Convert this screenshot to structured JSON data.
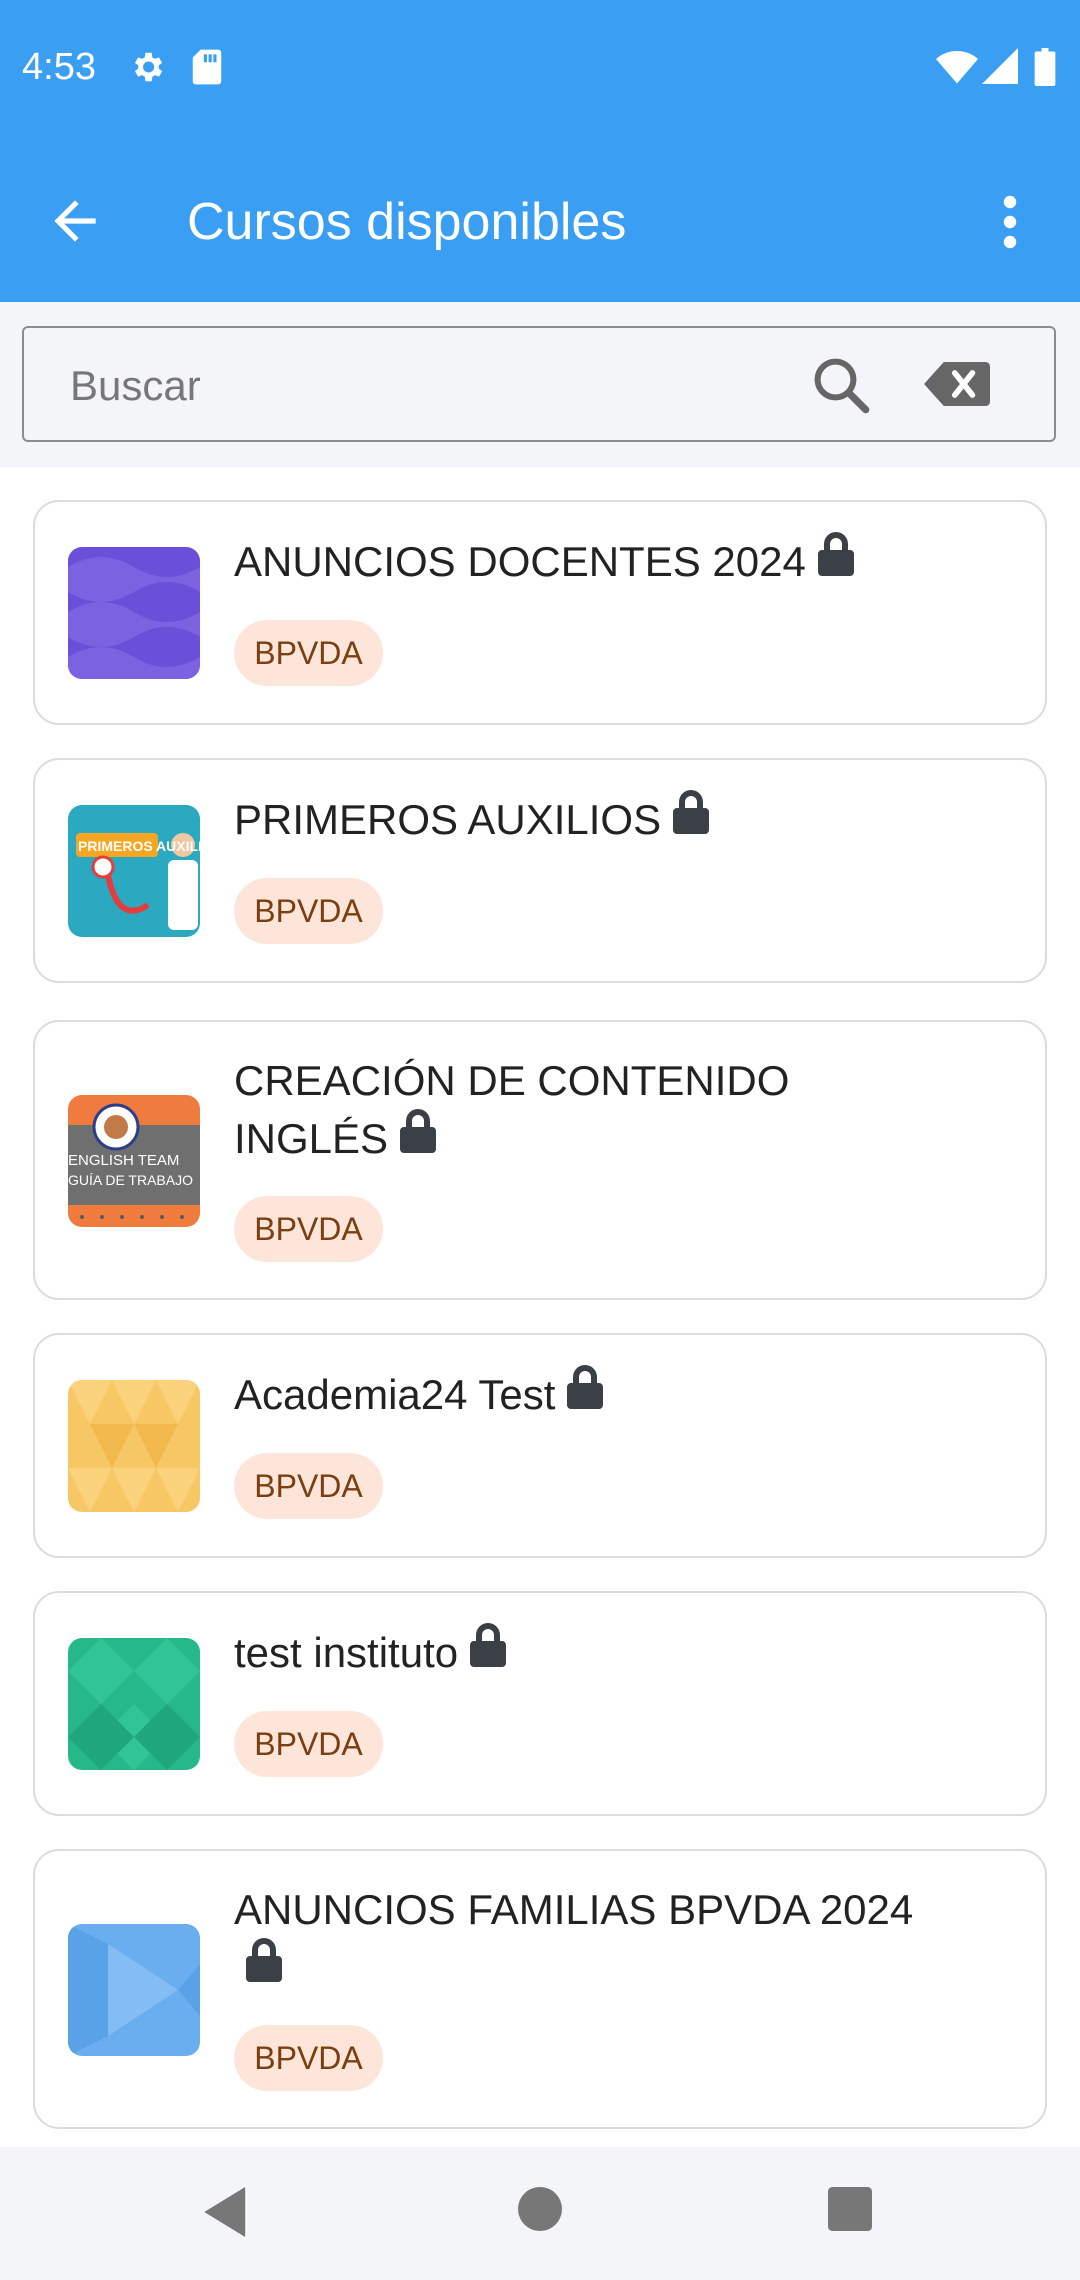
{
  "status": {
    "time": "4:53"
  },
  "header": {
    "title": "Cursos disponibles"
  },
  "search": {
    "placeholder": "Buscar",
    "value": ""
  },
  "courses": [
    {
      "title": "ANUNCIOS DOCENTES 2024",
      "badge": "BPVDA"
    },
    {
      "title": "PRIMEROS AUXILIOS",
      "badge": "BPVDA",
      "thumb_text": "PRIMEROS AUXILIOS"
    },
    {
      "title": "CREACIÓN DE CONTENIDO INGLÉS",
      "badge": "BPVDA",
      "thumb_line1": "ENGLISH TEAM",
      "thumb_line2": "GUÍA DE TRABAJO"
    },
    {
      "title": "Academia24 Test",
      "badge": "BPVDA"
    },
    {
      "title": "test instituto",
      "badge": "BPVDA"
    },
    {
      "title": "ANUNCIOS FAMILIAS BPVDA 2024",
      "badge": "BPVDA"
    }
  ],
  "colors": {
    "primary": "#3a9ff2",
    "badge_bg": "#fde6d9",
    "badge_text": "#7a3e10",
    "lock": "#3b3f46"
  },
  "icons": [
    "settings-icon",
    "sd-card-icon",
    "wifi-icon",
    "signal-icon",
    "battery-icon",
    "back-arrow-icon",
    "more-vert-icon",
    "search-icon",
    "backspace-clear-icon",
    "lock-icon",
    "nav-back-icon",
    "nav-home-icon",
    "nav-recents-icon"
  ]
}
